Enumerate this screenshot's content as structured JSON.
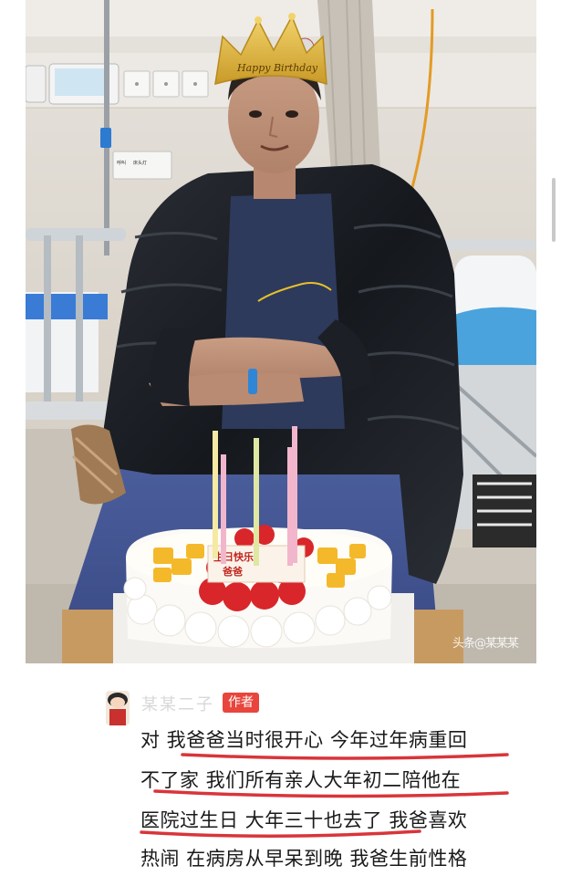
{
  "photo": {
    "crown_text": "Happy Birthday",
    "cake_plaque": [
      "生日快乐",
      "爸爸"
    ],
    "wall_labels": [
      "呼叫",
      "床头灯"
    ],
    "watermark": "头条@某某某"
  },
  "comment": {
    "author_name": "某某二子",
    "author_badge": "作者",
    "lines": [
      "对 我爸爸当时很开心 今年过年病重回",
      "不了家 我们所有亲人大年初二陪他在",
      "医院过生日 大年三十也去了 我爸喜欢",
      "热闹 在病房从早呆到晚 我爸生前性格"
    ]
  },
  "colors": {
    "badge": "#e8453c",
    "underline": "#d8353a",
    "text": "#1a1a1a"
  }
}
